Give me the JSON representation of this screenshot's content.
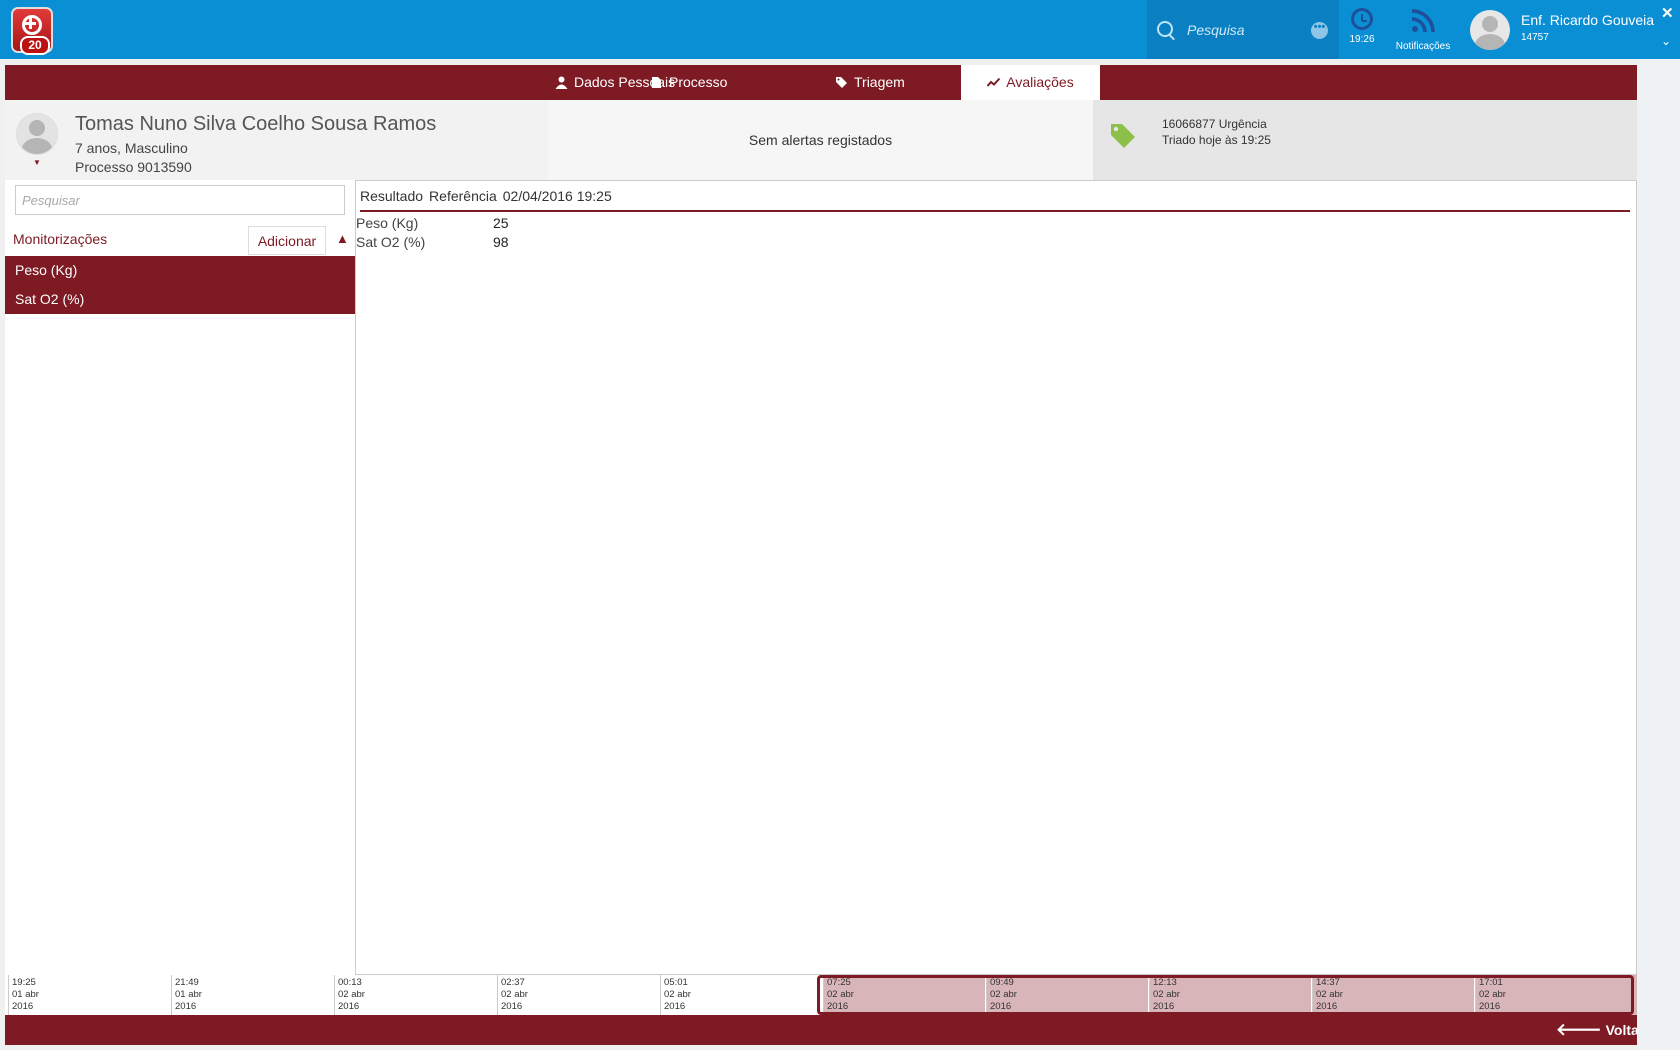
{
  "topbar": {
    "logo_badge": "20",
    "search_placeholder": "Pesquisa",
    "more_label": "•••",
    "clock_time": "19:26",
    "notifications_label": "Notificações",
    "user_name": "Enf. Ricardo Gouveia",
    "user_number": "14757",
    "close_label": "✕",
    "down_label": "⌄"
  },
  "tabs": [
    {
      "label": "Dados Pessoais",
      "icon": "person-icon"
    },
    {
      "label": "Processo",
      "icon": "document-icon"
    },
    {
      "label": "Triagem",
      "icon": "tag-icon"
    },
    {
      "label": "Avaliações",
      "icon": "trend-icon",
      "active": true
    }
  ],
  "patient": {
    "name": "Tomas Nuno Silva Coelho Sousa Ramos",
    "age_sex": "7 anos, Masculino",
    "process": "Processo 9013590"
  },
  "alerts": "Sem alertas registados",
  "episode": {
    "line1": "16066877 Urgência",
    "line2": "Triado hoje às 19:25"
  },
  "left_panel": {
    "search_placeholder": "Pesquisar",
    "title": "Monitorizações",
    "add_label": "Adicionar",
    "collapse_label": "▲",
    "items": [
      "Peso (Kg)",
      "Sat O2 (%)"
    ]
  },
  "results": {
    "header_result": "Resultado",
    "header_reference": "Referência",
    "header_datetime": "02/04/2016 19:25",
    "rows": [
      {
        "label": "Peso (Kg)",
        "value": "25"
      },
      {
        "label": "Sat O2 (%)",
        "value": "98"
      }
    ]
  },
  "timeline": [
    {
      "time": "19:25",
      "date": "01 abr",
      "year": "2016",
      "selected": false
    },
    {
      "time": "21:49",
      "date": "01 abr",
      "year": "2016",
      "selected": false
    },
    {
      "time": "00:13",
      "date": "02 abr",
      "year": "2016",
      "selected": false
    },
    {
      "time": "02:37",
      "date": "02 abr",
      "year": "2016",
      "selected": false
    },
    {
      "time": "05:01",
      "date": "02 abr",
      "year": "2016",
      "selected": false
    },
    {
      "time": "07:25",
      "date": "02 abr",
      "year": "2016",
      "selected": true
    },
    {
      "time": "09:49",
      "date": "02 abr",
      "year": "2016",
      "selected": true
    },
    {
      "time": "12:13",
      "date": "02 abr",
      "year": "2016",
      "selected": true
    },
    {
      "time": "14:37",
      "date": "02 abr",
      "year": "2016",
      "selected": true
    },
    {
      "time": "17:01",
      "date": "02 abr",
      "year": "2016",
      "selected": true
    }
  ],
  "footer": {
    "back_label": "Voltar"
  },
  "colors": {
    "topbar": "#0a8fd4",
    "accent": "#7d1a23",
    "timeline_selected": "#d8b5b9"
  }
}
